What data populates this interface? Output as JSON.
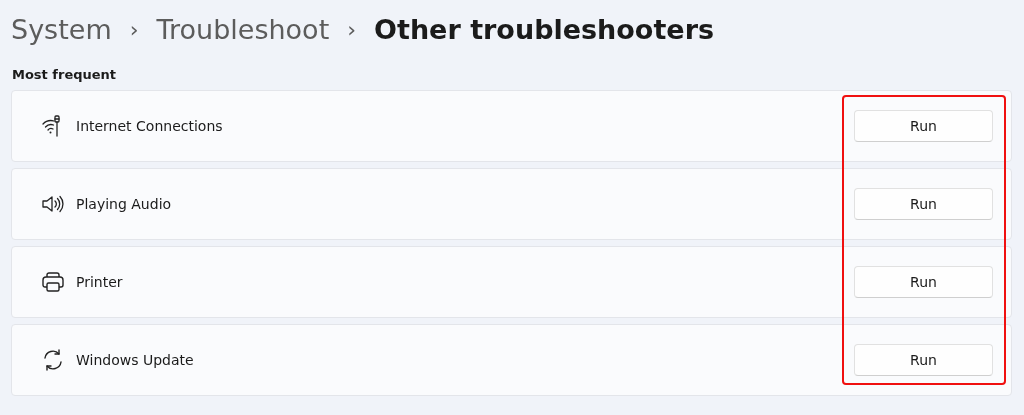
{
  "breadcrumb": [
    {
      "label": "System",
      "current": false
    },
    {
      "label": "Troubleshoot",
      "current": false
    },
    {
      "label": "Other troubleshooters",
      "current": true
    }
  ],
  "separator": "›",
  "section_title": "Most frequent",
  "troubleshooters": [
    {
      "kind": "network",
      "label": "Internet Connections",
      "button": "Run"
    },
    {
      "kind": "audio",
      "label": "Playing Audio",
      "button": "Run"
    },
    {
      "kind": "printer",
      "label": "Printer",
      "button": "Run"
    },
    {
      "kind": "update",
      "label": "Windows Update",
      "button": "Run"
    }
  ],
  "buttons_highlighted": true
}
